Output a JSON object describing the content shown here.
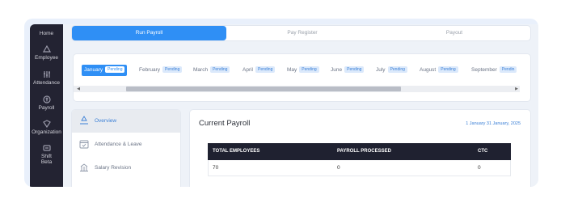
{
  "sidebar": {
    "items": [
      {
        "label": "Home",
        "icon": "home-icon"
      },
      {
        "label": "Employee",
        "icon": "employee-icon"
      },
      {
        "label": "Attendance",
        "icon": "attendance-icon"
      },
      {
        "label": "Payroll",
        "icon": "payroll-icon"
      },
      {
        "label": "Organization",
        "icon": "organization-icon"
      },
      {
        "label": "Shift",
        "icon": "shift-icon"
      },
      {
        "label": "Beta"
      }
    ]
  },
  "tabs": [
    "Run Payroll",
    "Pay Register",
    "Payout"
  ],
  "months": [
    {
      "name": "January",
      "status": "Pending"
    },
    {
      "name": "February",
      "status": "Pending"
    },
    {
      "name": "March",
      "status": "Pending"
    },
    {
      "name": "April",
      "status": "Pending"
    },
    {
      "name": "May",
      "status": "Pending"
    },
    {
      "name": "June",
      "status": "Pending"
    },
    {
      "name": "July",
      "status": "Pending"
    },
    {
      "name": "August",
      "status": "Pending"
    },
    {
      "name": "September",
      "status": "Pendin"
    }
  ],
  "scrollbar": {
    "left_arrow": "◀",
    "right_arrow": "▶"
  },
  "menu": [
    {
      "label": "Overview",
      "icon": "overview-icon"
    },
    {
      "label": "Attendance & Leave",
      "icon": "calendar-icon"
    },
    {
      "label": "Salary Revision",
      "icon": "salary-revision-icon"
    }
  ],
  "content": {
    "title": "Current Payroll",
    "date_range": "1 January 31 January, 2025",
    "table": {
      "headers": [
        "TOTAL EMPLOYEES",
        "PAYROLL PROCESSED",
        "CTC"
      ],
      "row": [
        "70",
        "0",
        "0"
      ]
    }
  },
  "colors": {
    "accent": "#2f8ff5",
    "sidebar_bg": "#232332",
    "table_header_bg": "#1f2130",
    "frame_bg": "#e9f0fb"
  }
}
